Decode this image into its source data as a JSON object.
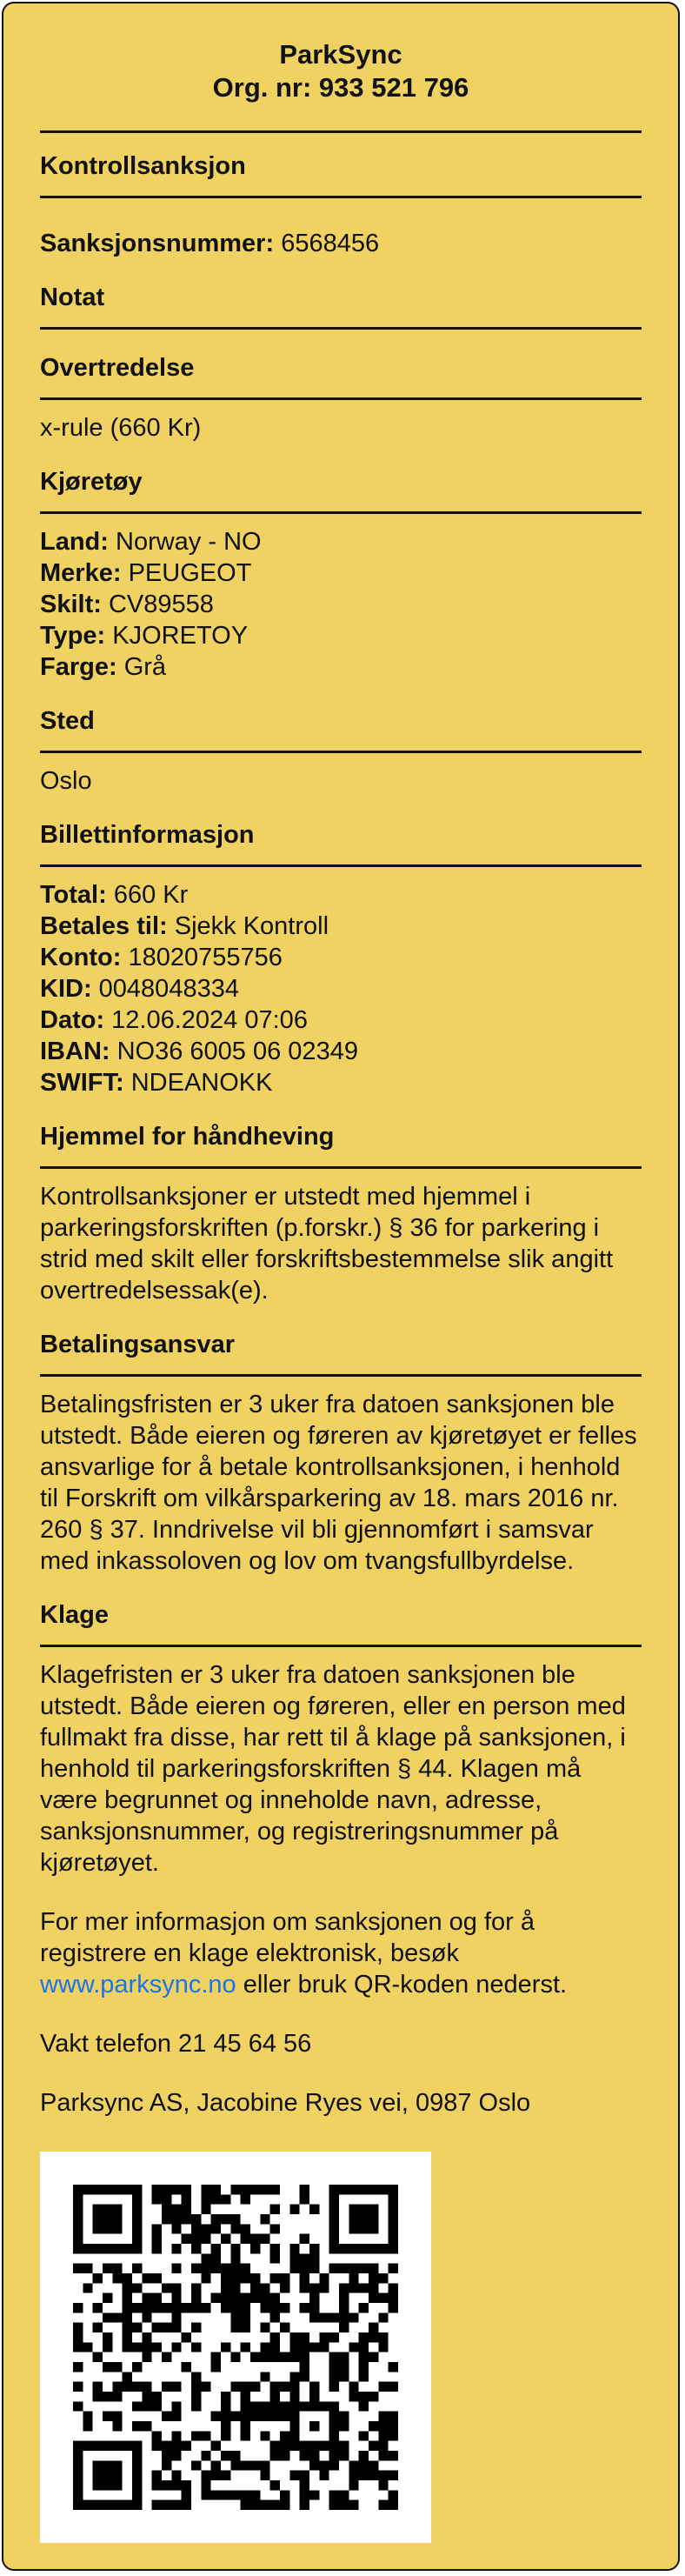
{
  "header": {
    "company": "ParkSync",
    "org_nr": "Org. nr: 933 521 796"
  },
  "kontroll": {
    "title": "Kontrollsanksjon",
    "sanksjon_label": "Sanksjonsnummer:",
    "sanksjon_value": "6568456"
  },
  "notat": {
    "title": "Notat"
  },
  "overtredelse": {
    "title": "Overtredelse",
    "value": "x-rule (660 Kr)"
  },
  "kjoretoy": {
    "title": "Kjøretøy",
    "rows": [
      {
        "label": "Land:",
        "value": "Norway - NO"
      },
      {
        "label": "Merke:",
        "value": "PEUGEOT"
      },
      {
        "label": "Skilt:",
        "value": "CV89558"
      },
      {
        "label": "Type:",
        "value": "KJORETOY"
      },
      {
        "label": "Farge:",
        "value": "Grå"
      }
    ]
  },
  "sted": {
    "title": "Sted",
    "value": "Oslo"
  },
  "billett": {
    "title": "Billettinformasjon",
    "rows": [
      {
        "label": "Total:",
        "value": "660 Kr"
      },
      {
        "label": "Betales til:",
        "value": "Sjekk Kontroll"
      },
      {
        "label": "Konto:",
        "value": "18020755756"
      },
      {
        "label": "KID:",
        "value": "0048048334"
      },
      {
        "label": "Dato:",
        "value": "12.06.2024 07:06"
      },
      {
        "label": "IBAN:",
        "value": "NO36 6005 06 02349"
      },
      {
        "label": "SWIFT:",
        "value": "NDEANOKK"
      }
    ]
  },
  "hjemmel": {
    "title": "Hjemmel for håndheving",
    "text": "Kontrollsanksjoner er utstedt med hjemmel i parkeringsforskriften (p.forskr.) § 36 for parkering i strid med skilt eller forskriftsbestemmelse slik angitt overtredelsessak(e)."
  },
  "betaling": {
    "title": "Betalingsansvar",
    "text": "Betalingsfristen er 3 uker fra datoen sanksjonen ble utstedt. Både eieren og føreren av kjøretøyet er felles ansvarlige for å betale kontrollsanksjonen, i henhold til Forskrift om vilkårsparkering av 18. mars 2016 nr. 260 § 37. Inndrivelse vil bli gjennomført i samsvar med inkassoloven og lov om tvangsfullbyrdelse."
  },
  "klage": {
    "title": "Klage",
    "text": "Klagefristen er 3 uker fra datoen sanksjonen ble utstedt. Både eieren og føreren, eller en person med fullmakt fra disse, har rett til å klage på sanksjonen, i henhold til parkeringsforskriften § 44. Klagen må være begrunnet og inneholde navn, adresse, sanksjonsnummer, og registreringsnummer på kjøretøyet.",
    "info_before": "For mer informasjon om sanksjonen og for å registrere en klage elektronisk, besøk ",
    "link_text": "www.parksync.no",
    "info_after": " eller bruk QR-koden nederst.",
    "vakt": "Vakt telefon 21 45 64 56",
    "address": "Parksync AS, Jacobine Ryes vei, 0987 Oslo"
  },
  "qr": {
    "icon": "qr-code-icon",
    "fg": "#000000",
    "bg": "#ffffff"
  }
}
